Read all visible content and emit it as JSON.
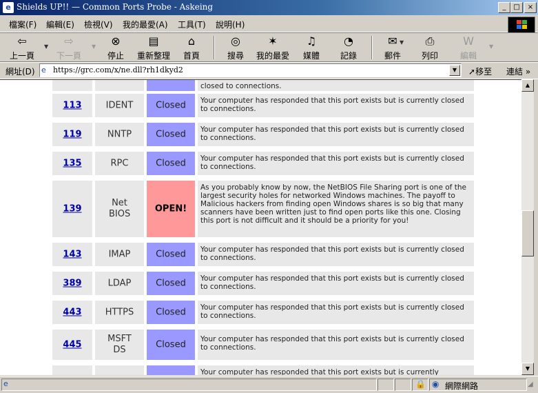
{
  "window": {
    "title": "Shields UP!! — Common Ports Probe - Askeing",
    "minimize": "_",
    "maximize": "□",
    "close": "×"
  },
  "menu": [
    {
      "label": "檔案(F)"
    },
    {
      "label": "編輯(E)"
    },
    {
      "label": "檢視(V)"
    },
    {
      "label": "我的最愛(A)"
    },
    {
      "label": "工具(T)"
    },
    {
      "label": "說明(H)"
    }
  ],
  "toolbar": {
    "back": "上一頁",
    "forward": "下一頁",
    "stop": "停止",
    "refresh": "重新整理",
    "home": "首頁",
    "search": "搜尋",
    "favorites": "我的最愛",
    "media": "媒體",
    "history": "記錄",
    "mail": "郵件",
    "print": "列印",
    "edit": "編輯"
  },
  "address": {
    "label": "網址(D)",
    "url": "https://grc.com/x/ne.dll?rh1dkyd2",
    "go": "移至",
    "links": "連結"
  },
  "table": {
    "rows": [
      {
        "port": "113",
        "service": "IDENT",
        "status": "Closed",
        "desc": "Your computer has responded that this port exists but is currently closed to connections."
      },
      {
        "port": "119",
        "service": "NNTP",
        "status": "Closed",
        "desc": "Your computer has responded that this port exists but is currently closed to connections."
      },
      {
        "port": "135",
        "service": "RPC",
        "status": "Closed",
        "desc": "Your computer has responded that this port exists but is currently closed to connections."
      },
      {
        "port": "139",
        "service": "Net BIOS",
        "status": "OPEN!",
        "desc": "As you probably know by now, the NetBIOS File Sharing port is one of the largest security holes for networked Windows machines. The payoff to Malicious hackers from finding open Windows shares is so big that many scanners have been written just to find open ports like this one. Closing this port is not difficult and it should be a priority for you!"
      },
      {
        "port": "143",
        "service": "IMAP",
        "status": "Closed",
        "desc": "Your computer has responded that this port exists but is currently closed to connections."
      },
      {
        "port": "389",
        "service": "LDAP",
        "status": "Closed",
        "desc": "Your computer has responded that this port exists but is currently closed to connections."
      },
      {
        "port": "443",
        "service": "HTTPS",
        "status": "Closed",
        "desc": "Your computer has responded that this port exists but is currently closed to connections."
      },
      {
        "port": "445",
        "service": "MSFT DS",
        "status": "Closed",
        "desc": "Your computer has responded that this port exists but is currently closed to connections."
      }
    ],
    "partial_top_desc": "closed to connections.",
    "partial_bottom_desc": "Your computer has responded that this port exists but is currently"
  },
  "status": {
    "zone": "網際網路"
  }
}
